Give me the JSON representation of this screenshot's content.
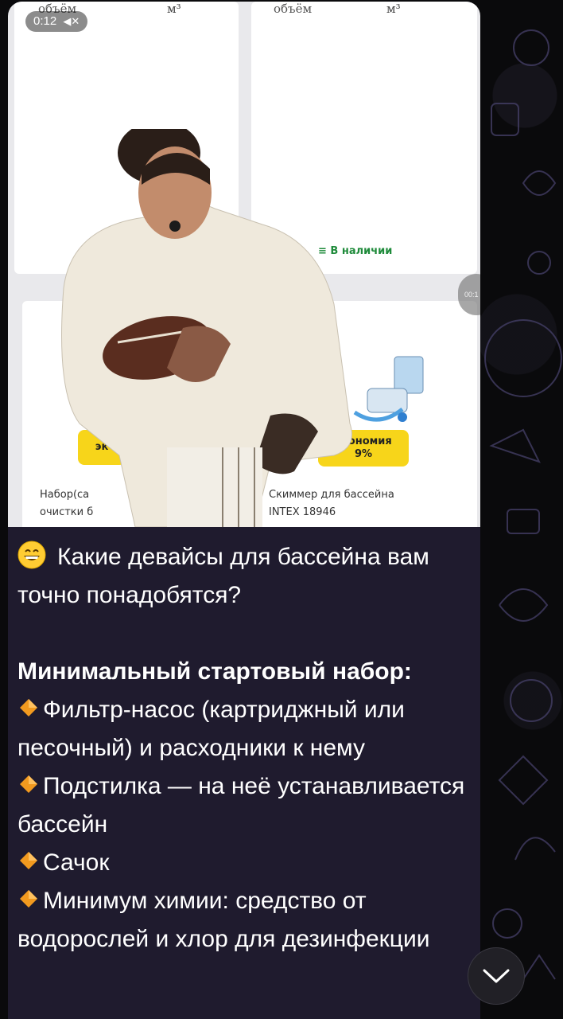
{
  "video": {
    "timer": "0:12",
    "muted_icon": "muted-speaker-icon",
    "seek_label": "00:1",
    "cards": {
      "left_top_label": "объём",
      "left_top_unit": "м³",
      "right_top_label": "объём",
      "right_top_unit": "м³",
      "stock_label": "≡ В наличии",
      "promo_left": "эк",
      "promo_right_line1": "экономия",
      "promo_right_line2": "9%",
      "product_left_line1": "Набор(са",
      "product_left_line2": "очистки б",
      "product_right_line1": "Скиммер для бассейна",
      "product_right_line2": "INTEX 18946"
    }
  },
  "message": {
    "intro_emoji": "grinning-face-emoji",
    "intro": "Какие девайсы для бассейна вам точно понадобятся?",
    "heading": "Минимальный стартовый набор:",
    "bullet_icon": "orange-diamond-icon",
    "items": [
      "Фильтр-насос (картриджный или песочный) и расходники к нему",
      "Подстилка — на неё устанавливается бассейн",
      "Сачок",
      "Минимум химии: средство от водорослей и хлор для дезинфекции"
    ]
  },
  "controls": {
    "scroll_down_icon": "chevron-down-icon"
  },
  "colors": {
    "bubble_bg": "#1f1b2e",
    "accent_orange": "#f29a1f",
    "promo_yellow": "#f7d51a",
    "stock_green": "#1f8b3b"
  }
}
